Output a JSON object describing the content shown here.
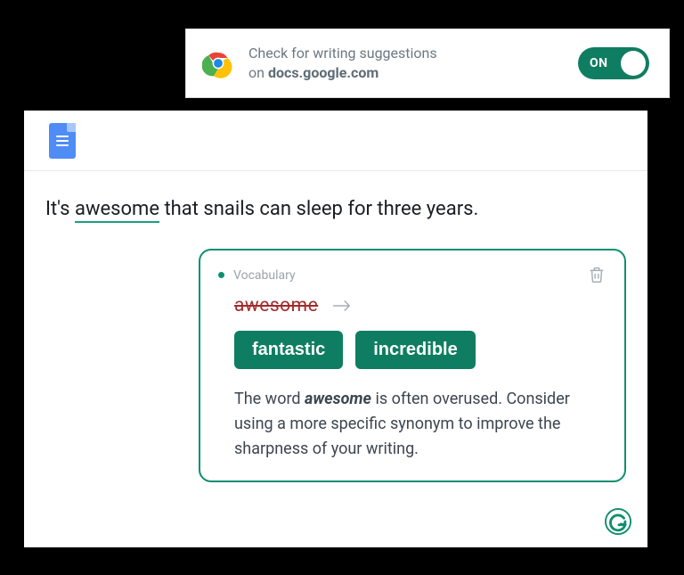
{
  "extension": {
    "line1": "Check for writing suggestions",
    "line2_prefix": "on ",
    "domain": "docs.google.com",
    "toggle_label": "ON",
    "toggle_state": true
  },
  "sentence": {
    "before": "It's ",
    "highlight": "awesome",
    "after": " that snails can sleep for three years."
  },
  "card": {
    "category": "Vocabulary",
    "striked_word": "awesome",
    "replacements": [
      "fantastic",
      "incredible"
    ],
    "explain_pre": "The word ",
    "explain_word": "awesome",
    "explain_post": " is often overused. Consider using a more specific synonym to improve the sharpness of your writing."
  },
  "colors": {
    "accent": "#0f8e6f",
    "toggle": "#0f7d61",
    "strike": "#a22b2b"
  }
}
